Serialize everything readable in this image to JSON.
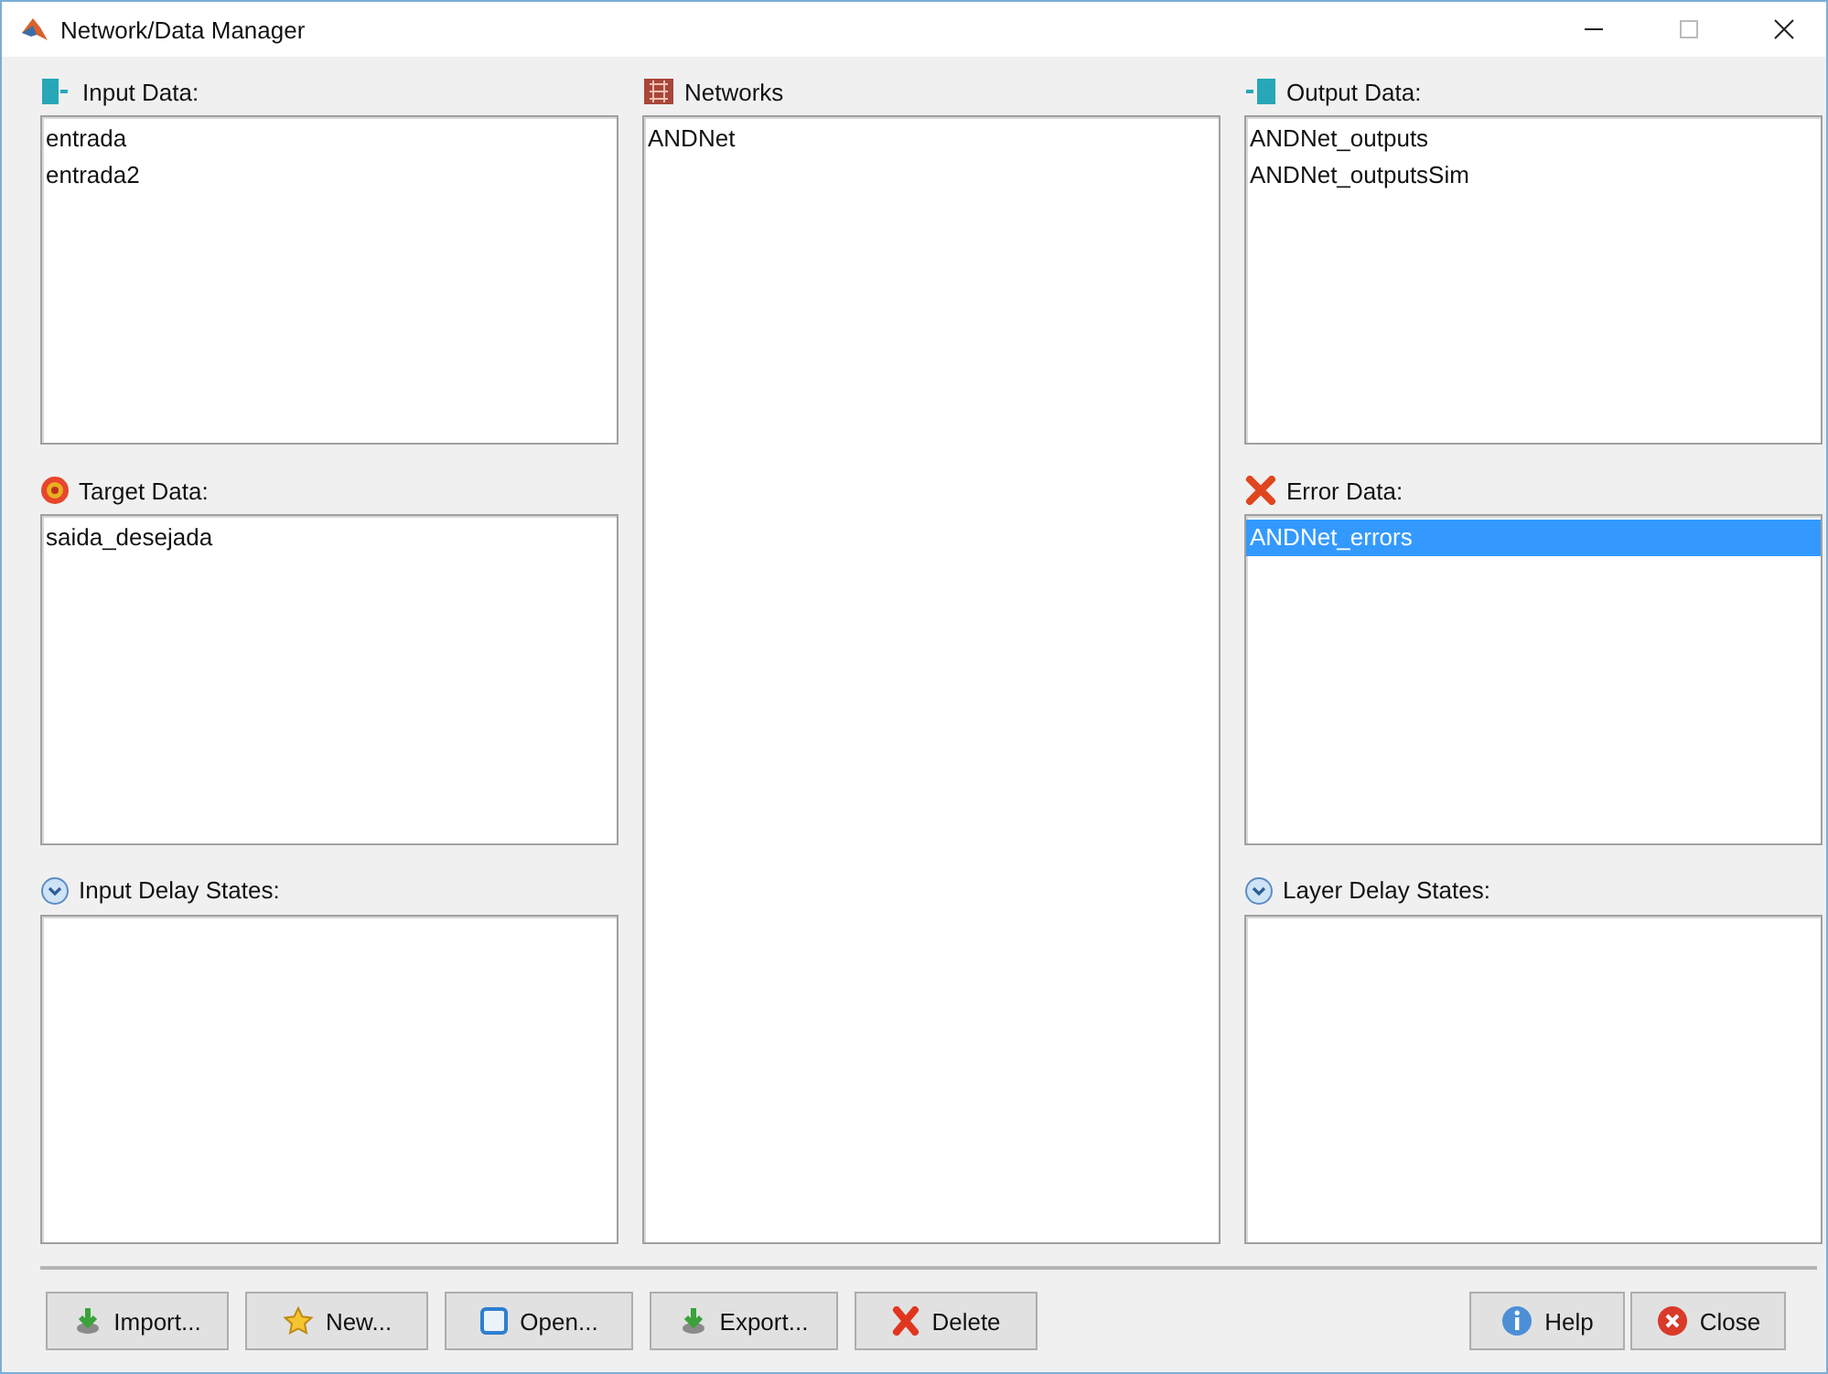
{
  "window": {
    "title": "Network/Data Manager"
  },
  "columns": [
    [
      {
        "title": "Input Data:",
        "kind": "input",
        "items": [
          {
            "text": "entrada",
            "selected": false
          },
          {
            "text": "entrada2",
            "selected": false
          }
        ]
      },
      {
        "title": "Target Data:",
        "kind": "target",
        "items": [
          {
            "text": "saida_desejada",
            "selected": false
          }
        ]
      },
      {
        "title": "Input Delay States:",
        "kind": "delay"
      }
    ],
    [
      {
        "title": "Networks",
        "kind": "network",
        "items": [
          {
            "text": "ANDNet",
            "selected": false
          }
        ]
      }
    ],
    [
      {
        "title": "Output Data:",
        "kind": "output",
        "items": [
          {
            "text": "ANDNet_outputs",
            "selected": false
          },
          {
            "text": "ANDNet_outputsSim",
            "selected": false
          }
        ]
      },
      {
        "title": "Error Data:",
        "kind": "error",
        "items": [
          {
            "text": "ANDNet_errors",
            "selected": true
          }
        ]
      },
      {
        "title": "Layer Delay States:",
        "kind": "delay"
      }
    ]
  ],
  "left_buttons": [
    {
      "label": "Import...",
      "kind": "import"
    },
    {
      "label": "New...",
      "kind": "new"
    },
    {
      "label": "Open...",
      "kind": "open"
    },
    {
      "label": "Export...",
      "kind": "export"
    },
    {
      "label": "Delete",
      "kind": "delete"
    }
  ],
  "right_buttons": [
    {
      "label": "Help",
      "kind": "help"
    },
    {
      "label": "Close",
      "kind": "close"
    }
  ]
}
